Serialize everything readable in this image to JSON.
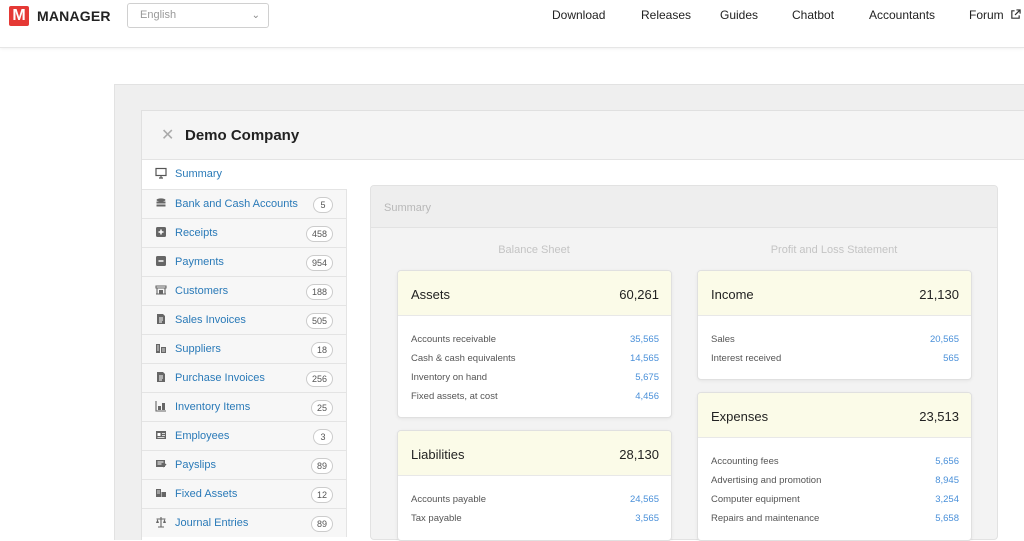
{
  "header": {
    "logo_letter": "M",
    "app_name": "MANAGER",
    "language": "English",
    "nav": [
      "Download",
      "Releases",
      "Guides",
      "Chatbot",
      "Accountants",
      "Forum"
    ],
    "forum_external_icon": "external-link-icon"
  },
  "company": {
    "name": "Demo Company"
  },
  "sidebar": {
    "items": [
      {
        "label": "Summary",
        "icon": "monitor-icon",
        "count": null
      },
      {
        "label": "Bank and Cash Accounts",
        "icon": "coins-icon",
        "count": "5"
      },
      {
        "label": "Receipts",
        "icon": "plus-square-icon",
        "count": "458"
      },
      {
        "label": "Payments",
        "icon": "minus-square-icon",
        "count": "954"
      },
      {
        "label": "Customers",
        "icon": "customers-icon",
        "count": "188"
      },
      {
        "label": "Sales Invoices",
        "icon": "document-icon",
        "count": "505"
      },
      {
        "label": "Suppliers",
        "icon": "building-icon",
        "count": "18"
      },
      {
        "label": "Purchase Invoices",
        "icon": "document-icon",
        "count": "256"
      },
      {
        "label": "Inventory Items",
        "icon": "boxes-icon",
        "count": "25"
      },
      {
        "label": "Employees",
        "icon": "id-card-icon",
        "count": "3"
      },
      {
        "label": "Payslips",
        "icon": "payslip-icon",
        "count": "89"
      },
      {
        "label": "Fixed Assets",
        "icon": "fixed-asset-icon",
        "count": "12"
      },
      {
        "label": "Journal Entries",
        "icon": "scale-icon",
        "count": "89"
      }
    ]
  },
  "summary": {
    "title": "Summary",
    "balance_sheet_label": "Balance Sheet",
    "pl_label": "Profit and Loss Statement",
    "assets": {
      "title": "Assets",
      "total": "60,261",
      "rows": [
        {
          "label": "Accounts receivable",
          "value": "35,565"
        },
        {
          "label": "Cash & cash equivalents",
          "value": "14,565"
        },
        {
          "label": "Inventory on hand",
          "value": "5,675"
        },
        {
          "label": "Fixed assets, at cost",
          "value": "4,456"
        }
      ]
    },
    "liabilities": {
      "title": "Liabilities",
      "total": "28,130",
      "rows": [
        {
          "label": "Accounts payable",
          "value": "24,565"
        },
        {
          "label": "Tax payable",
          "value": "3,565"
        }
      ]
    },
    "income": {
      "title": "Income",
      "total": "21,130",
      "rows": [
        {
          "label": "Sales",
          "value": "20,565"
        },
        {
          "label": "Interest received",
          "value": "565"
        }
      ]
    },
    "expenses": {
      "title": "Expenses",
      "total": "23,513",
      "rows": [
        {
          "label": "Accounting fees",
          "value": "5,656"
        },
        {
          "label": "Advertising and promotion",
          "value": "8,945"
        },
        {
          "label": "Computer equipment",
          "value": "3,254"
        },
        {
          "label": "Repairs and maintenance",
          "value": "5,658"
        }
      ]
    }
  }
}
